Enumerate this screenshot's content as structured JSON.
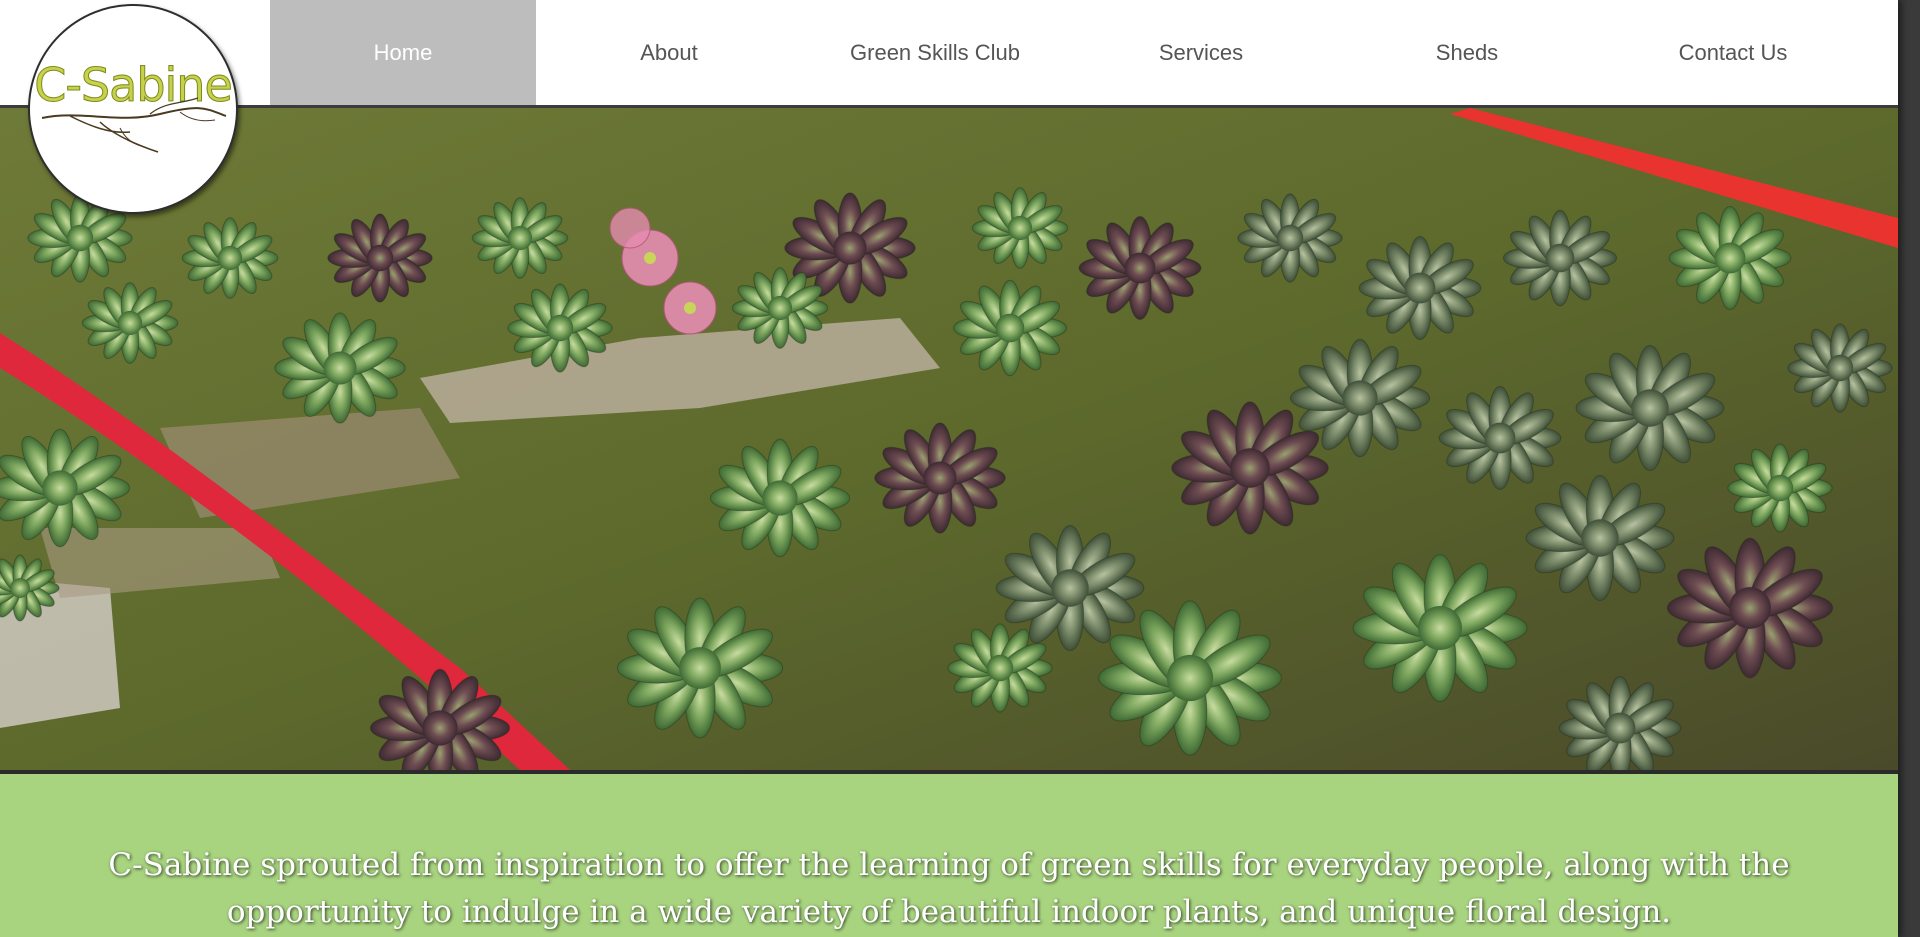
{
  "logo": {
    "text": "C-Sabine",
    "icon": "branch-logo-icon"
  },
  "nav": {
    "items": [
      {
        "label": "Home",
        "active": true
      },
      {
        "label": "About",
        "active": false
      },
      {
        "label": "Green Skills Club",
        "active": false
      },
      {
        "label": "Services",
        "active": false
      },
      {
        "label": "Sheds",
        "active": false
      },
      {
        "label": "Contact Us",
        "active": false
      }
    ]
  },
  "hero": {
    "image": "succulent-garden-photo"
  },
  "banner": {
    "tagline_line1": "C-Sabine sprouted from inspiration to offer the learning of green skills for everyday people, along with the",
    "tagline_line2": "opportunity to indulge in a wide variety of beautiful indoor plants, and unique floral design."
  },
  "colors": {
    "active_nav_bg": "#bdbdbd",
    "nav_text": "#555555",
    "banner_bg": "#a8d47f",
    "logo_text": "#c7d14a"
  }
}
